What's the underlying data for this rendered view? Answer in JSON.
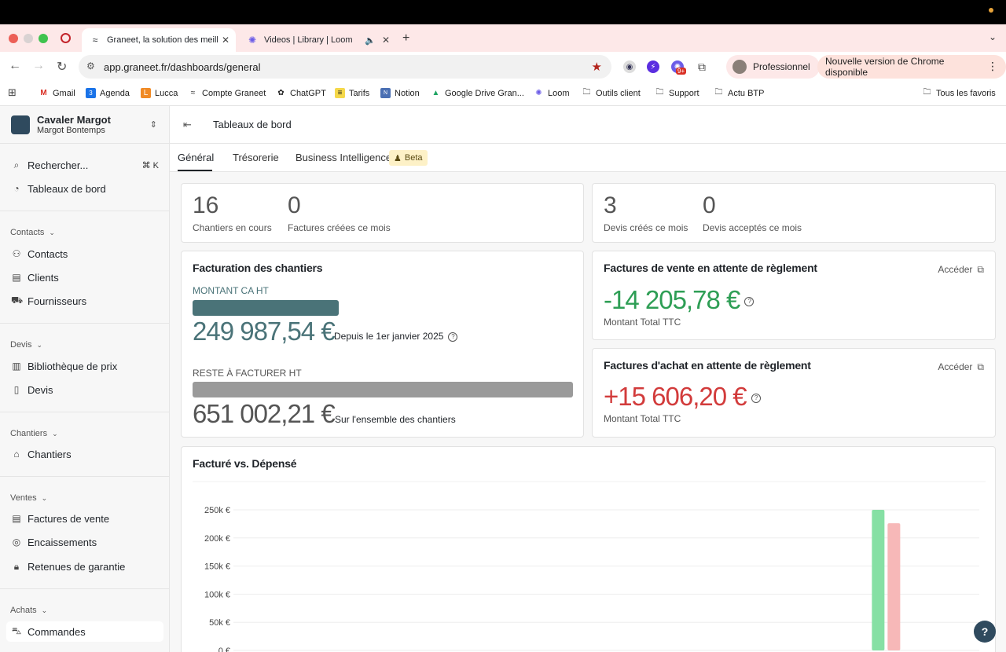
{
  "browser": {
    "tabs": [
      {
        "title": "Graneet, la solution des meill",
        "active": true
      },
      {
        "title": "Videos | Library | Loom",
        "active": false
      }
    ],
    "url": "app.graneet.fr/dashboards/general",
    "profile": "Professionnel",
    "update": "Nouvelle version de Chrome disponible",
    "bookmarks": [
      "Gmail",
      "Agenda",
      "Lucca",
      "Compte Graneet",
      "ChatGPT",
      "Tarifs",
      "Notion",
      "Google Drive Gran...",
      "Loom",
      "Outils client",
      "Support",
      "Actu BTP"
    ],
    "all_bookmarks": "Tous les favoris",
    "ext_badge": "9+"
  },
  "sidebar": {
    "org_name": "Cavaler Margot",
    "org_user": "Margot Bontemps",
    "search": "Rechercher...",
    "search_kbd": "⌘ K",
    "dashboards": "Tableaux de bord",
    "sections": [
      {
        "title": "Contacts",
        "items": [
          "Contacts",
          "Clients",
          "Fournisseurs"
        ]
      },
      {
        "title": "Devis",
        "items": [
          "Bibliothèque de prix",
          "Devis"
        ]
      },
      {
        "title": "Chantiers",
        "items": [
          "Chantiers"
        ]
      },
      {
        "title": "Ventes",
        "items": [
          "Factures de vente",
          "Encaissements",
          "Retenues de garantie"
        ]
      },
      {
        "title": "Achats",
        "items": [
          "Commandes"
        ]
      }
    ]
  },
  "header": {
    "title": "Tableaux de bord"
  },
  "tabs": {
    "general": "Général",
    "treasury": "Trésorerie",
    "bi": "Business Intelligence",
    "beta": "Beta"
  },
  "kpis": {
    "left": [
      {
        "value": "16",
        "label": "Chantiers en cours"
      },
      {
        "value": "0",
        "label": "Factures créées ce mois"
      }
    ],
    "right": [
      {
        "value": "3",
        "label": "Devis créés ce mois"
      },
      {
        "value": "0",
        "label": "Devis acceptés ce mois"
      }
    ]
  },
  "billing": {
    "title": "Facturation des chantiers",
    "ca_label": "MONTANT CA HT",
    "ca_amount": "249 987,54 €",
    "ca_note": "Depuis le 1er janvier 2025",
    "ca_fraction": 0.384,
    "remaining_label": "RESTE À FACTURER HT",
    "remaining_amount": "651 002,21 €",
    "remaining_note": "Sur l'ensemble des chantiers",
    "remaining_fraction": 1.0
  },
  "sales_pending": {
    "title": "Factures de vente en attente de règlement",
    "link": "Accéder",
    "amount": "-14 205,78 €",
    "sublabel": "Montant Total TTC"
  },
  "purchase_pending": {
    "title": "Factures d'achat en attente de règlement",
    "link": "Accéder",
    "amount": "+15 606,20 €",
    "sublabel": "Montant Total TTC"
  },
  "chart_card": {
    "title": "Facturé vs. Dépensé"
  },
  "chart_data": {
    "type": "bar",
    "title": "Facturé vs. Dépensé",
    "yticks": [
      "0 €",
      "50k €",
      "100k €",
      "150k €",
      "200k €",
      "250k €"
    ],
    "ylim": [
      0,
      250000
    ],
    "grid": true,
    "series": [
      {
        "color": "#86e0a4",
        "values": [
          0,
          0,
          0,
          0,
          0,
          0,
          0,
          0,
          0,
          0,
          250000,
          0
        ]
      },
      {
        "color": "#f7b8b8",
        "values": [
          0,
          0,
          0,
          0,
          0,
          0,
          0,
          0,
          0,
          0,
          226000,
          0
        ]
      }
    ],
    "categories_count": 12
  },
  "colors": {
    "accent": "#4a7378",
    "negative_green": "#2e9e55",
    "positive_red": "#d23b3b",
    "muted_bar": "#9a9a9a"
  },
  "help_button": "?"
}
